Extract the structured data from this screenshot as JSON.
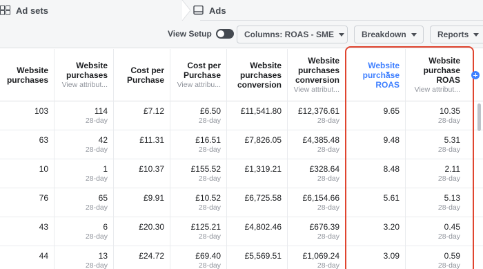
{
  "tabs": {
    "ad_sets": "Ad sets",
    "ads": "Ads"
  },
  "toolbar": {
    "view_setup": "View Setup",
    "columns": "Columns: ROAS - SME",
    "breakdown": "Breakdown",
    "reports": "Reports"
  },
  "headers": [
    {
      "title": "Website purchases",
      "sub": ""
    },
    {
      "title": "Website purchases",
      "sub": "View attribut..."
    },
    {
      "title": "Cost per Purchase",
      "sub": ""
    },
    {
      "title": "Cost per Purchase",
      "sub": "View attribu..."
    },
    {
      "title": "Website purchases conversion",
      "sub": ""
    },
    {
      "title": "Website purchases conversion",
      "sub": "View attribut..."
    },
    {
      "title": "Website purchase ROAS",
      "sub": ""
    },
    {
      "title": "Website purchase ROAS",
      "sub": "View attribut..."
    }
  ],
  "rows": [
    [
      "103",
      "114",
      "£7.12",
      "£6.50",
      "£11,541.80",
      "£12,376.61",
      "9.65",
      "10.35"
    ],
    [
      "63",
      "42",
      "£11.31",
      "£16.51",
      "£7,826.05",
      "£4,385.48",
      "9.48",
      "5.31"
    ],
    [
      "10",
      "1",
      "£10.37",
      "£155.52",
      "£1,319.21",
      "£328.64",
      "8.48",
      "2.11"
    ],
    [
      "76",
      "65",
      "£9.91",
      "£10.52",
      "£6,725.58",
      "£6,154.66",
      "5.61",
      "5.13"
    ],
    [
      "43",
      "6",
      "£20.30",
      "£125.21",
      "£4,802.46",
      "£676.39",
      "3.20",
      "0.45"
    ],
    [
      "44",
      "13",
      "£24.72",
      "£69.40",
      "£5,569.51",
      "£1,069.24",
      "3.09",
      "0.59"
    ]
  ],
  "attribution_label": "28-day",
  "colors": {
    "highlight_border": "#e0452f",
    "sorted_header": "#4080ff"
  }
}
